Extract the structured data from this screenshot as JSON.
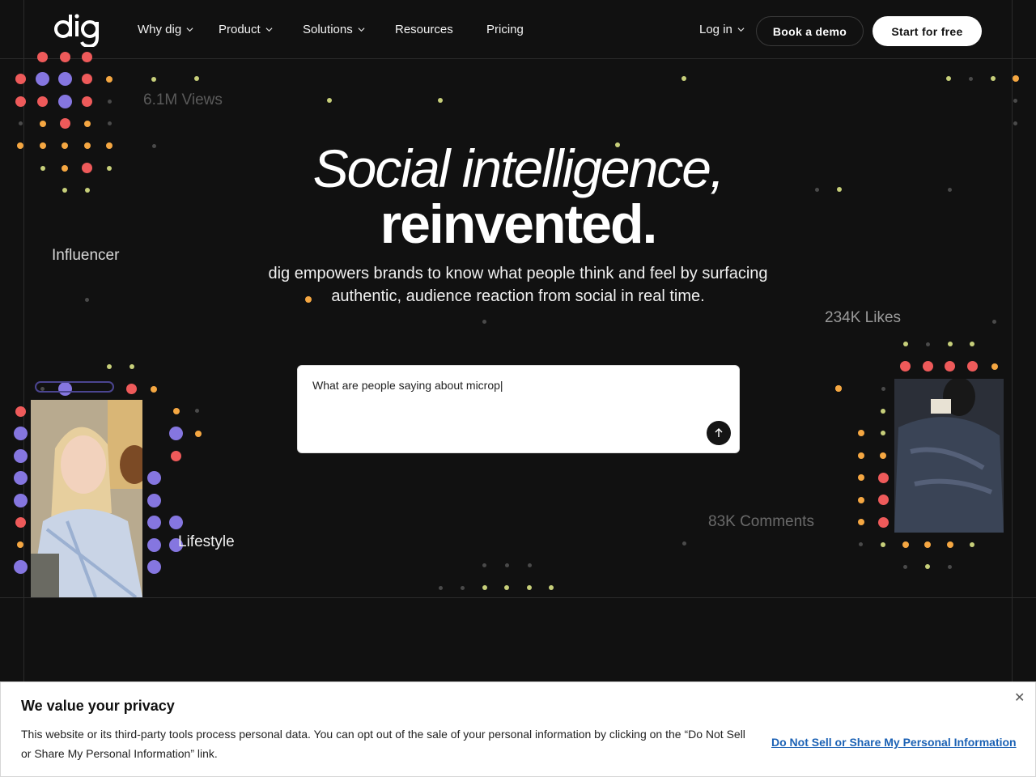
{
  "brand": {
    "logo_text": "dig"
  },
  "nav": {
    "items": [
      {
        "label": "Why dig",
        "has_dropdown": true
      },
      {
        "label": "Product",
        "has_dropdown": true
      },
      {
        "label": "Solutions",
        "has_dropdown": true
      },
      {
        "label": "Resources",
        "has_dropdown": false
      },
      {
        "label": "Pricing",
        "has_dropdown": false
      }
    ],
    "login_label": "Log in",
    "book_demo_label": "Book a demo",
    "start_free_label": "Start for free"
  },
  "hero": {
    "headline_line1": "Social intelligence,",
    "headline_line2": "reinvented.",
    "subtitle": "dig empowers brands to know what people think and feel by surfacing authentic, audience reaction from social in real time."
  },
  "floating_labels": {
    "views": "6.1M Views",
    "influencer": "Influencer",
    "likes": "234K Likes",
    "comments": "83K Comments",
    "lifestyle": "Lifestyle"
  },
  "search": {
    "value": "What are people saying about microp|",
    "send_icon": "arrow-up-icon"
  },
  "cookie_banner": {
    "title": "We value your privacy",
    "body": "This website or its third-party tools process personal data. You can opt out of the sale of your personal information by clicking on the “Do Not Sell or Share My Personal Information” link.",
    "link_label": "Do Not Sell or Share My Personal Information",
    "close_icon": "close-icon"
  },
  "colors": {
    "background": "#111111",
    "dot_red": "#ee5a5a",
    "dot_orange": "#f5a742",
    "dot_purple": "#8576e0",
    "dot_green": "#c7cf7a",
    "dot_grey": "#4a4a4a",
    "link_blue": "#1c62b5"
  }
}
